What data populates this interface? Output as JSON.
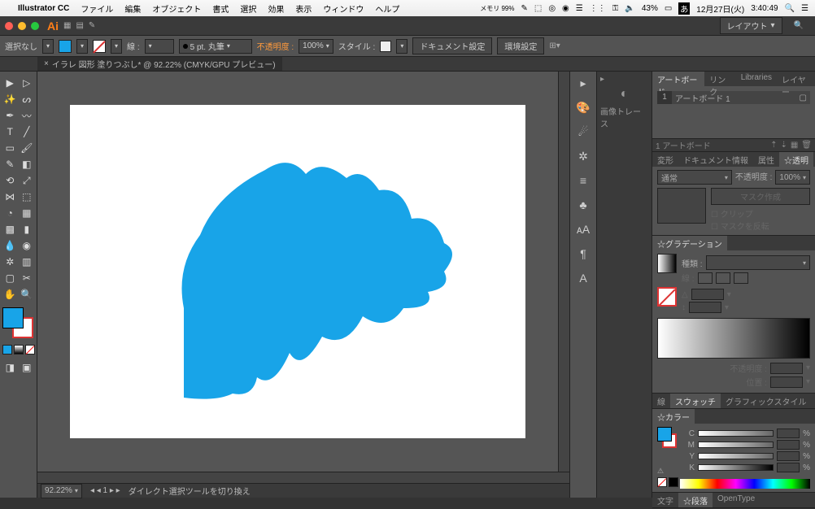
{
  "menubar": {
    "app": "Illustrator CC",
    "items": [
      "ファイル",
      "編集",
      "オブジェクト",
      "書式",
      "選択",
      "効果",
      "表示",
      "ウィンドウ",
      "ヘルプ"
    ],
    "memory": "メモリ 99%",
    "battery": "43%",
    "date": "12月27日(火)",
    "time": "3:40:49"
  },
  "appbar": {
    "layout": "レイアウト"
  },
  "controlbar": {
    "noSelect": "選択なし",
    "stroke_label": "線 :",
    "stroke_weight": "5 pt. 丸筆",
    "opacity_label": "不透明度 :",
    "opacity_value": "100%",
    "style_label": "スタイル :",
    "doc_setup": "ドキュメント設定",
    "prefs": "環境設定",
    "fill_color": "#18a4e8"
  },
  "doc": {
    "tab": "イラレ 図形 塗りつぶし* @ 92.22% (CMYK/GPU プレビュー)",
    "zoom": "92.22%"
  },
  "statusbar": {
    "hint": "ダイレクト選択ツールを切り換え"
  },
  "trace": {
    "label": "画像トレース"
  },
  "panels": {
    "artboards": {
      "tabs": [
        "アートボード",
        "リンク",
        "Libraries",
        "レイヤー"
      ],
      "num": "1",
      "name": "アートボード 1",
      "count": "1 アートボード"
    },
    "transparency": {
      "tabs": [
        "変形",
        "ドキュメント情報",
        "属性",
        "☆透明"
      ],
      "mode": "通常",
      "opacity_label": "不透明度 :",
      "opacity": "100%",
      "make_mask": "マスク作成",
      "clip": "クリップ",
      "invert": "マスクを反転"
    },
    "gradient": {
      "tab": "☆グラデーション",
      "type_label": "種類 :",
      "stroke_label": "線 :",
      "angle_label": "△",
      "ratio_label": "↕",
      "opacity_label": "不透明度 :",
      "pos_label": "位置 :"
    },
    "swatch": {
      "tabs": [
        "線",
        "スウォッチ",
        "グラフィックスタイル"
      ]
    },
    "color": {
      "tab": "☆カラー",
      "c": "C",
      "m": "M",
      "y": "Y",
      "k": "K",
      "pct": "%"
    },
    "type": {
      "tabs": [
        "文字",
        "☆段落",
        "OpenType"
      ]
    }
  }
}
